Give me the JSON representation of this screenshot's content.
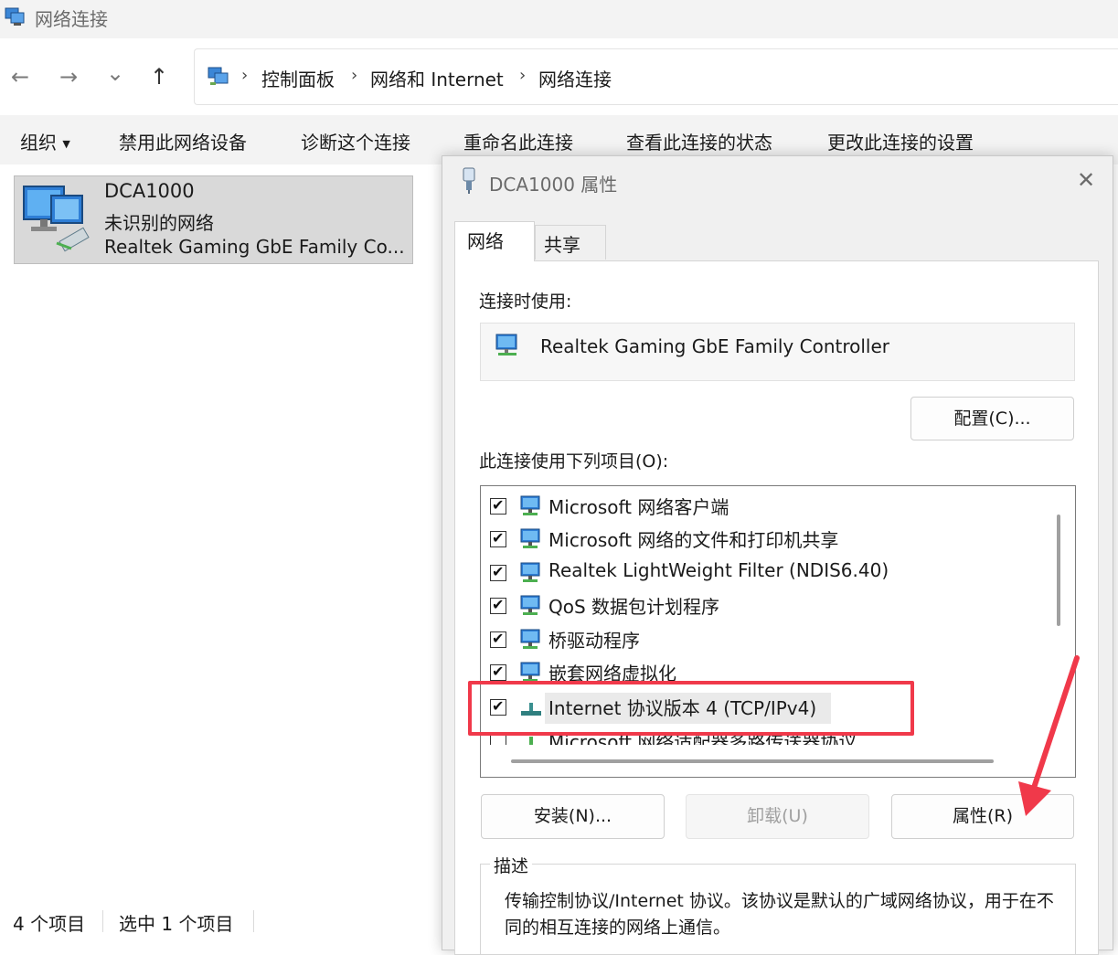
{
  "window": {
    "title": "网络连接"
  },
  "nav": {
    "back": "←",
    "forward": "→",
    "recent": "⌄",
    "up": "↑"
  },
  "breadcrumb": {
    "sep": "›",
    "items": [
      "控制面板",
      "网络和 Internet",
      "网络连接"
    ]
  },
  "commands": [
    "组织",
    "禁用此网络设备",
    "诊断这个连接",
    "重命名此连接",
    "查看此连接的状态",
    "更改此连接的设置"
  ],
  "connection": {
    "name": "DCA1000",
    "status": "未识别的网络",
    "device": "Realtek Gaming GbE Family Co..."
  },
  "statusbar": {
    "count": "4 个项目",
    "selected": "选中 1 个项目"
  },
  "dialog": {
    "title": "DCA1000 属性",
    "close": "✕",
    "tabs": [
      "网络",
      "共享"
    ],
    "connect_using_label": "连接时使用:",
    "adapter": "Realtek Gaming GbE Family Controller",
    "configure_button": "配置(C)...",
    "items_label": "此连接使用下列项目(O):",
    "items": [
      {
        "label": "Microsoft 网络客户端",
        "checked": true
      },
      {
        "label": "Microsoft 网络的文件和打印机共享",
        "checked": true
      },
      {
        "label": "Realtek LightWeight Filter (NDIS6.40)",
        "checked": true
      },
      {
        "label": "QoS 数据包计划程序",
        "checked": true
      },
      {
        "label": "桥驱动程序",
        "checked": true
      },
      {
        "label": "嵌套网络虚拟化",
        "checked": true
      },
      {
        "label": "Internet 协议版本 4 (TCP/IPv4)",
        "checked": true,
        "selected": true
      },
      {
        "label": "Microsoft 网络适配器多路传送器协议",
        "checked": false
      }
    ],
    "install_button": "安装(N)...",
    "uninstall_button": "卸载(U)",
    "properties_button": "属性(R)",
    "description_title": "描述",
    "description_text": "传输控制协议/Internet 协议。该协议是默认的广域网络协议，用于在不同的相互连接的网络上通信。"
  },
  "colors": {
    "highlight": "#f0394a",
    "selection": "#d9d9d9",
    "accent": "#1e78c8"
  }
}
